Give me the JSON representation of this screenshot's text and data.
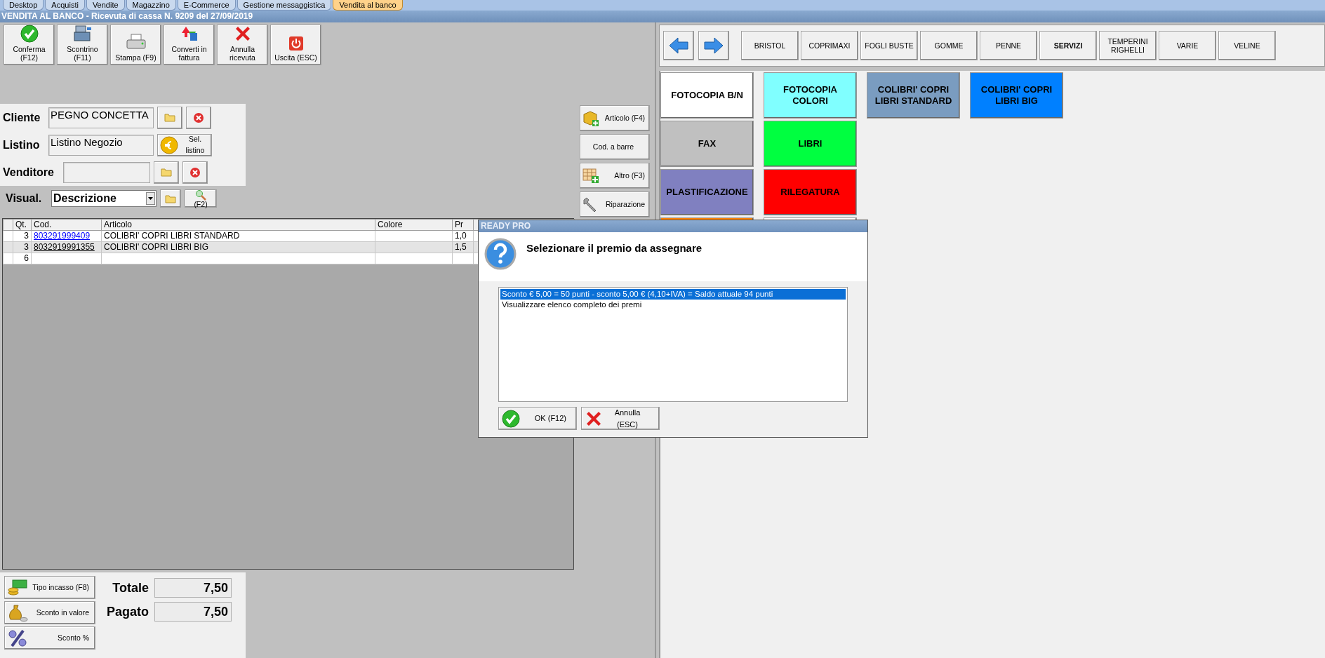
{
  "tabs": [
    {
      "label": "Desktop",
      "selected": false
    },
    {
      "label": "Acquisti",
      "selected": false
    },
    {
      "label": "Vendite",
      "selected": false
    },
    {
      "label": "Magazzino",
      "selected": false
    },
    {
      "label": "E-Commerce",
      "selected": false
    },
    {
      "label": "Gestione messaggistica",
      "selected": false
    },
    {
      "label": "Vendita al banco",
      "selected": true
    }
  ],
  "window": {
    "title": "VENDITA AL BANCO - Ricevuta di cassa N. 9209 del 27/09/2019"
  },
  "toolbar": [
    {
      "label": "Conferma (F12)",
      "kind": "check"
    },
    {
      "label": "Scontrino (F11)",
      "kind": "register"
    },
    {
      "label": "Stampa (F9)",
      "kind": "printer"
    },
    {
      "label": "Converti in fattura",
      "kind": "convert"
    },
    {
      "label": "Annulla ricevuta",
      "kind": "cross"
    },
    {
      "label": "Uscita (ESC)",
      "kind": "power"
    }
  ],
  "form": [
    {
      "label": "Cliente",
      "value": "PEGNO CONCETTA",
      "kind": "pick"
    },
    {
      "label": "Listino",
      "value": "Listino Negozio",
      "kind": "list",
      "button": "Sel. listino"
    },
    {
      "label": "Venditore",
      "kind": "pick"
    }
  ],
  "visual": {
    "label": "Visual.",
    "value": "Descrizione",
    "button": "(F2)"
  },
  "table": {
    "columns": [
      "Qt.",
      "Cod.",
      "Articolo",
      "Colore",
      "Pr"
    ],
    "rows": [
      {
        "qt": "3",
        "code": "803291999409",
        "color": "#0000ff",
        "article": "COLIBRI' COPRI LIBRI STANDARD",
        "price": "1,0",
        "selected": false
      },
      {
        "qt": "3",
        "code": "8032919991355",
        "color": "#000000",
        "article": "COLIBRI' COPRI LIBRI BIG",
        "price": "1,5",
        "selected": true
      },
      {
        "qt": "6",
        "selected": false
      }
    ]
  },
  "payment_buttons": [
    {
      "label": "Tipo incasso (F8)",
      "kind": "cash"
    },
    {
      "label": "Sconto in valore",
      "kind": "bag"
    },
    {
      "label": "Sconto %",
      "kind": "percent"
    }
  ],
  "totals": [
    {
      "label": "Totale",
      "value": "7,50"
    },
    {
      "label": "Pagato",
      "value": "7,50"
    }
  ],
  "side_buttons": [
    {
      "label": "Articolo (F4)",
      "kind": "box"
    },
    {
      "label": "Cod. a barre",
      "kind": "plain"
    },
    {
      "label": "Altro (F3)",
      "kind": "grid"
    },
    {
      "label": "Riparazione",
      "kind": "wrench"
    }
  ],
  "categories": [
    {
      "label": "BRISTOL",
      "selected": false
    },
    {
      "label": "COPRIMAXI",
      "selected": false
    },
    {
      "label": "FOGLI BUSTE",
      "selected": false
    },
    {
      "label": "GOMME",
      "selected": false
    },
    {
      "label": "PENNE",
      "selected": false
    },
    {
      "label": "SERVIZI",
      "selected": true
    },
    {
      "label": "TEMPERINI RIGHELLI",
      "selected": false
    },
    {
      "label": "VARIE",
      "selected": false
    },
    {
      "label": "VELINE",
      "selected": false
    }
  ],
  "tile_columns": [
    [
      {
        "label": "FOTOCOPIA B/N",
        "color": "#ffffff"
      },
      {
        "label": "FAX",
        "color": "#c0c0c0"
      },
      {
        "label": "PLASTIFICAZIONE",
        "color": "#8080c0"
      },
      {
        "color": "#ff8000"
      }
    ],
    [
      {
        "label": "FOTOCOPIA COLORI",
        "color": "#80ffff"
      },
      {
        "label": "LIBRI",
        "color": "#00ff40"
      },
      {
        "label": "RILEGATURA",
        "color": "#ff0000"
      },
      {
        "color": "#ffffff"
      }
    ],
    [
      {
        "label": "COLIBRI' COPRI LIBRI STANDARD",
        "color": "#7a9cc0"
      }
    ],
    [
      {
        "label": "COLIBRI' COPRI LIBRI BIG",
        "color": "#0080ff"
      }
    ]
  ],
  "dialog": {
    "title": "READY PRO",
    "message": "Selezionare il premio da assegnare",
    "options": [
      {
        "label": "Sconto € 5,00 = 50 punti  - sconto 5,00 € (4,10+IVA) = Saldo attuale 94 punti",
        "selected": true
      },
      {
        "label": "Visualizzare elenco completo dei premi",
        "selected": false
      }
    ],
    "buttons": [
      {
        "label": "OK (F12)",
        "kind": "check"
      },
      {
        "label": "Annulla (ESC)",
        "kind": "cross"
      }
    ]
  }
}
